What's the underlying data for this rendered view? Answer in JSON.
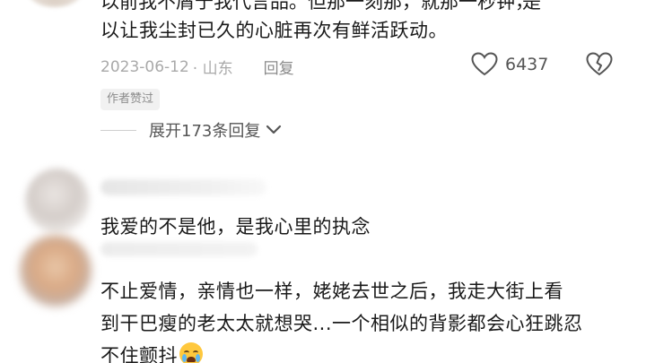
{
  "comment1": {
    "line_cut_left": "以前我不屑于我代言品。但那一刻那，就那一秒钟，",
    "line_cut_right": "是",
    "line2": "以让我尘封已久的心脏再次有鲜活跃动。",
    "date": "2023-06-12",
    "location": "· 山东",
    "reply_label": "回复",
    "like_count": "6437",
    "author_badge": "作者赞过",
    "expand_label": "展开173条回复"
  },
  "comment2": {
    "text": "我爱的不是他，是我心里的执念"
  },
  "comment3": {
    "line1": "不止爱情，亲情也一样，姥姥去世之后，我走大街上看",
    "line2": "到干巴瘦的老太太就想哭...一个相似的背影都会心狂跳忍",
    "line3": "不住颤抖"
  },
  "icons": {
    "like": "heart-outline-icon",
    "dislike": "broken-heart-icon",
    "expand": "chevron-down-icon",
    "emoji": "crying-face-emoji-icon"
  }
}
